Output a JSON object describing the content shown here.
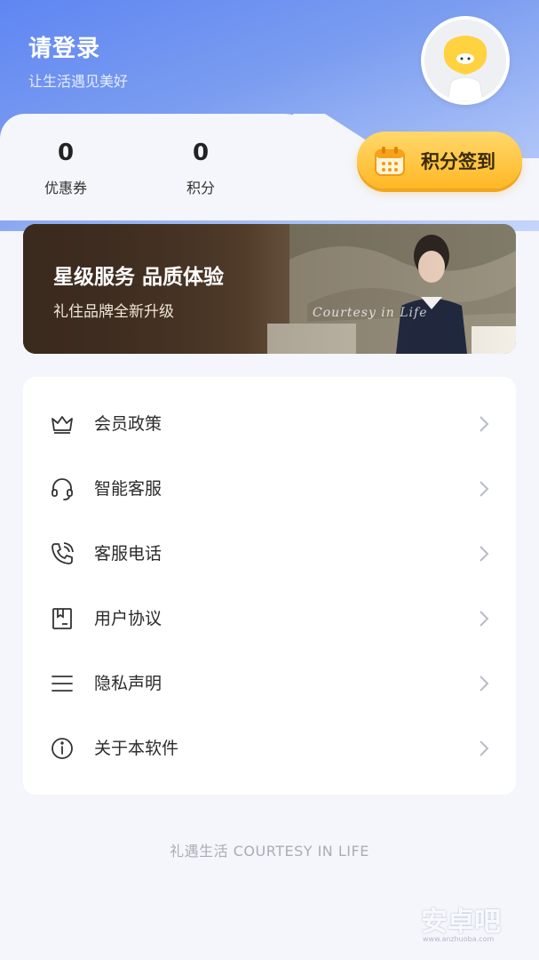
{
  "header": {
    "login_title": "请登录",
    "subtitle": "让生活遇见美好"
  },
  "stats": {
    "coupons": {
      "value": "0",
      "label": "优惠券"
    },
    "points": {
      "value": "0",
      "label": "积分"
    }
  },
  "signin": {
    "label": "积分签到",
    "icon": "calendar-icon"
  },
  "banner": {
    "title": "星级服务 品质体验",
    "subtitle": "礼住品牌全新升级",
    "script_text": "Courtesy in Life"
  },
  "menu": {
    "items": [
      {
        "label": "会员政策",
        "icon": "crown-icon"
      },
      {
        "label": "智能客服",
        "icon": "headset-icon"
      },
      {
        "label": "客服电话",
        "icon": "phone-icon"
      },
      {
        "label": "用户协议",
        "icon": "document-icon"
      },
      {
        "label": "隐私声明",
        "icon": "list-icon"
      },
      {
        "label": "关于本软件",
        "icon": "info-icon"
      }
    ]
  },
  "footer": {
    "text": "礼遇生活 COURTESY IN LIFE"
  },
  "watermark": {
    "text": "安卓吧",
    "sub": "www.anzhuoba.com"
  },
  "colors": {
    "hero_blue": "#5f86f2",
    "signin_gold": "#ffb826",
    "page_bg": "#f4f6fb"
  }
}
